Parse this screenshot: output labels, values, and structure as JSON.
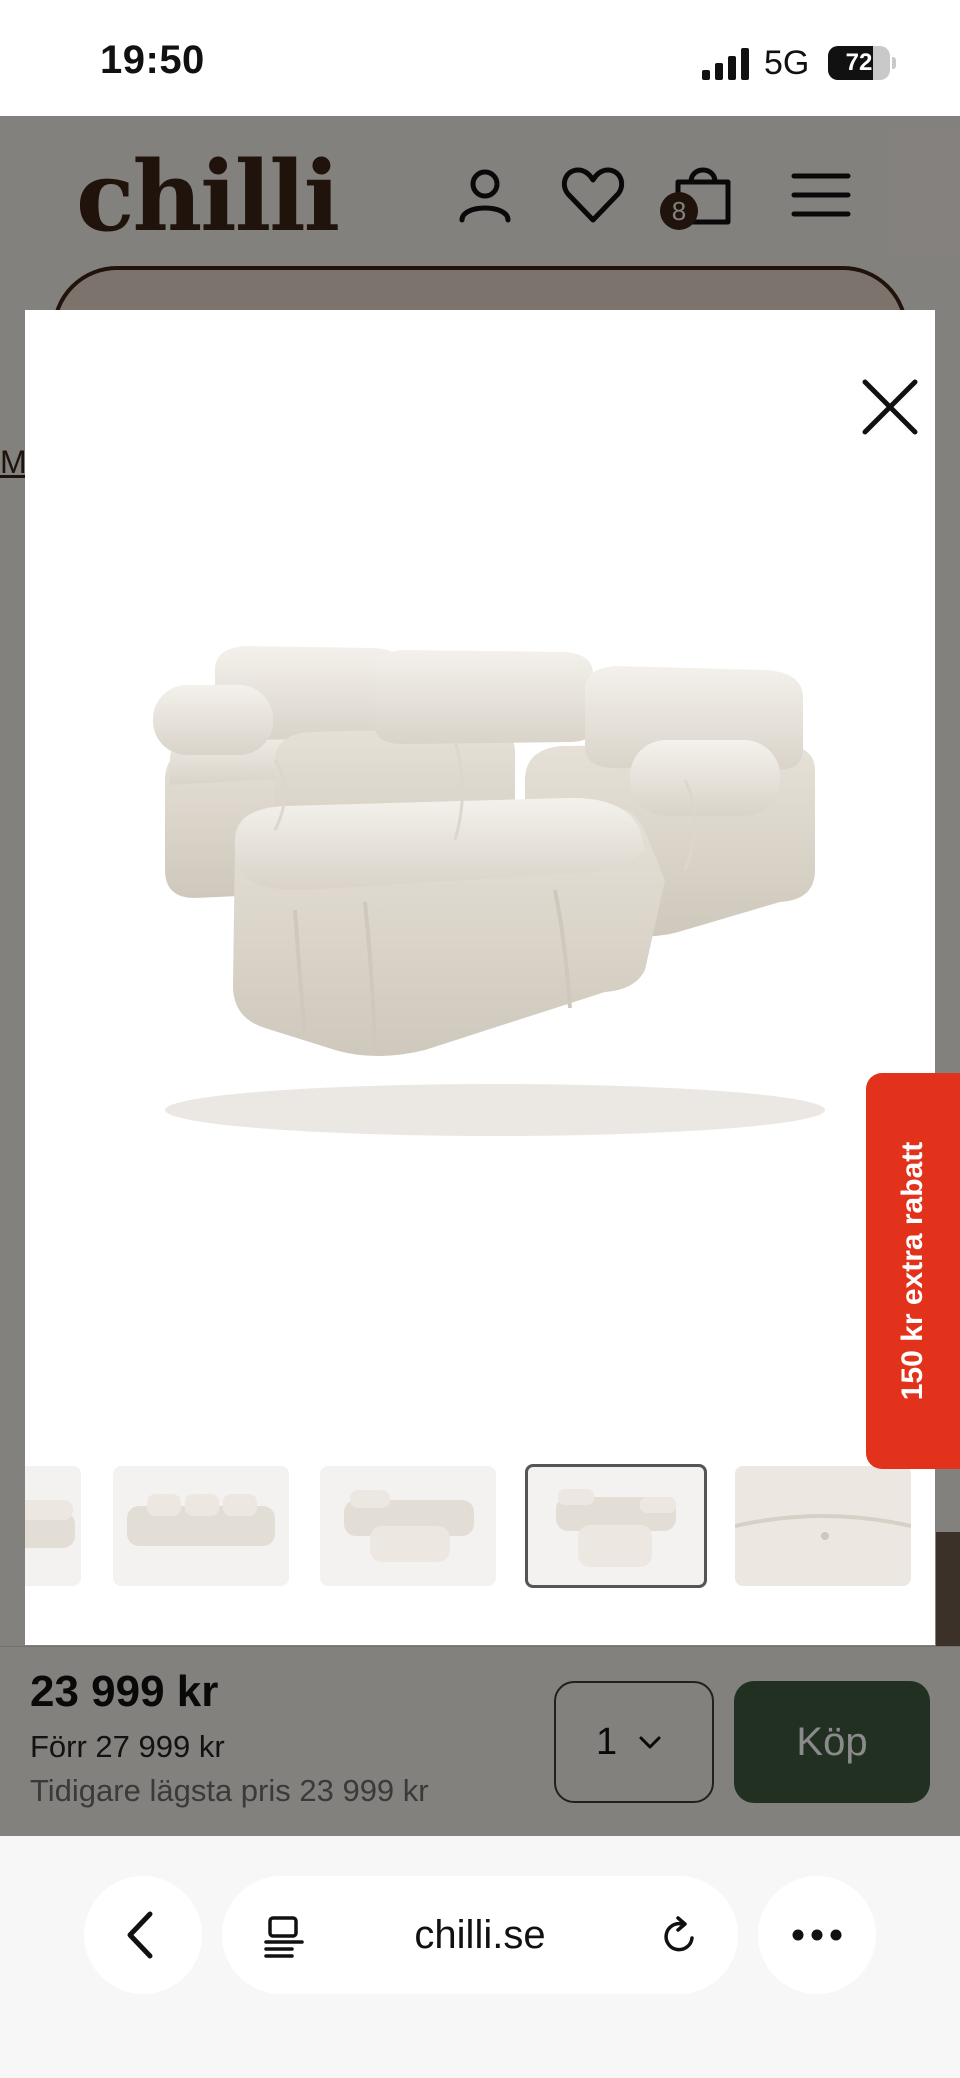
{
  "status_bar": {
    "time": "19:50",
    "network": "5G",
    "battery": "72",
    "battery_level": 0.72
  },
  "site": {
    "logo": "chilli",
    "cart_count": "8",
    "breadcrumb_fragment": "Mö",
    "icons": [
      "user-icon",
      "heart-icon",
      "cart-icon",
      "menu-icon"
    ]
  },
  "buy_bar": {
    "price": "23 999 kr",
    "previous_price": "Förr 27 999 kr",
    "lowest_price": "Tidigare lägsta pris 23 999 kr",
    "quantity": "1",
    "buy_label": "Köp"
  },
  "promo": {
    "label": "150 kr extra rabatt"
  },
  "gallery": {
    "thumbnail_count": 5,
    "active_thumbnail": 4
  },
  "browser": {
    "url": "chilli.se"
  },
  "colors": {
    "brand_brown": "#3b2416",
    "buy_green": "#3e5a3e",
    "promo_red": "#e3321b",
    "sofa_cream": "#ece8e1"
  }
}
